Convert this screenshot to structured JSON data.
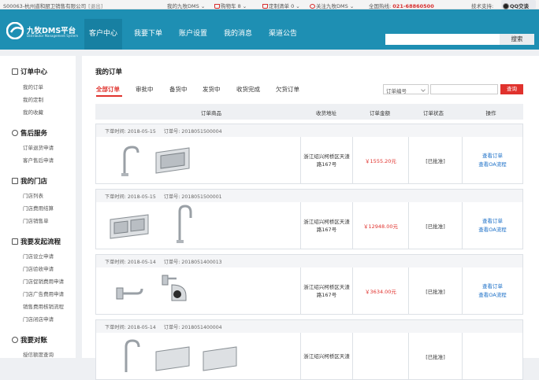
{
  "topbar": {
    "company": "S00063-杭州道和厨卫销售有限公司",
    "logout": "[退出]",
    "my_account": "我的九牧DMS",
    "cart": "购物车 8",
    "custom_list": "定制清单 0",
    "follow": "关注九牧DMS",
    "hotline_label": "全国热线:",
    "hotline": "021-68860500",
    "support_label": "技术支持:",
    "qq": "QQ交谈"
  },
  "header": {
    "logo_title": "九牧DMS平台",
    "logo_sub": "Distributor Management System",
    "nav": [
      "客户中心",
      "我要下单",
      "账户设置",
      "我的消息",
      "渠道公告"
    ],
    "search_placeholder": "",
    "search_button": "搜索"
  },
  "sidebar": {
    "sections": [
      {
        "title": "订单中心",
        "items": [
          "我的订单",
          "我的定制",
          "我的收藏"
        ]
      },
      {
        "title": "售后服务",
        "items": [
          "订单退货申请",
          "客户售后申请"
        ]
      },
      {
        "title": "我的门店",
        "items": [
          "门店列表",
          "门店费用结算",
          "门店销售单"
        ]
      },
      {
        "title": "我要发起流程",
        "items": [
          "门店设立申请",
          "门店验收申请",
          "门店促销费用申请",
          "门店广告费用申请",
          "销售费用核销流程",
          "门店闭店申请"
        ]
      },
      {
        "title": "我要对账",
        "items": [
          "授信额度查询"
        ]
      }
    ]
  },
  "main": {
    "title": "我的订单",
    "tabs": [
      "全部订单",
      "审批中",
      "备货中",
      "发货中",
      "收货完成",
      "欠货订单"
    ],
    "filter": {
      "select_value": "订单编号",
      "input_value": "",
      "query_button": "查询"
    },
    "columns": [
      "订单商品",
      "收货地址",
      "订单金额",
      "订单状态",
      "操作"
    ],
    "orders": [
      {
        "time_label": "下单时间:",
        "time": "2018-05-15",
        "no_label": "订单号:",
        "no": "2018051500004",
        "products": [
          "faucet-icon",
          "sink-icon"
        ],
        "address": "浙江绍兴柯桥区天渣路167号",
        "amount": "￥1555.20元",
        "status": "[已批准]",
        "view": "查看订单",
        "flow": "查看OA流程"
      },
      {
        "time_label": "下单时间:",
        "time": "2018-05-15",
        "no_label": "订单号:",
        "no": "2018051500001",
        "products": [
          "sink-icon",
          "faucet-icon"
        ],
        "address": "浙江绍兴柯桥区天渣路167号",
        "amount": "￥12948.00元",
        "status": "[已批准]",
        "view": "查看订单",
        "flow": "查看OA流程"
      },
      {
        "time_label": "下单时间:",
        "time": "2018-05-14",
        "no_label": "订单号:",
        "no": "2018051400013",
        "products": [
          "hook-icon",
          "paper-holder-icon"
        ],
        "address": "浙江绍兴柯桥区天渣路167号",
        "amount": "￥3634.00元",
        "status": "[已批准]",
        "view": "查看订单",
        "flow": "查看OA流程"
      },
      {
        "time_label": "下单时间:",
        "time": "2018-05-14",
        "no_label": "订单号:",
        "no": "2018051400004",
        "products": [
          "faucet-icon",
          "sink-icon",
          "sink-icon"
        ],
        "address": "浙江绍兴柯桥区天渣",
        "amount": "",
        "status": "[已批准]",
        "view": "",
        "flow": ""
      }
    ]
  },
  "colors": {
    "header": "#1e8fb3",
    "accent": "#e0322d",
    "link": "#1b6fc7"
  }
}
